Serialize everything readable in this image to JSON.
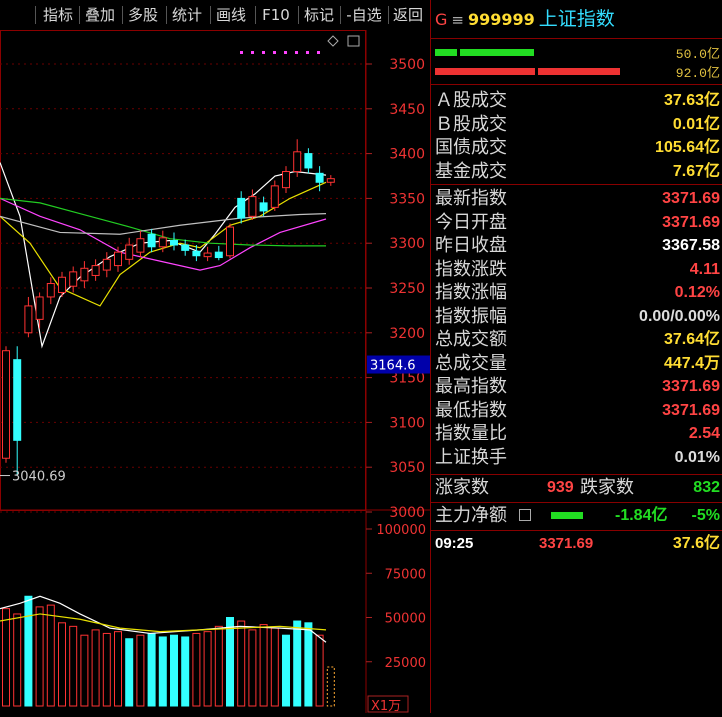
{
  "toolbar": {
    "buttons": [
      "指标",
      "叠加",
      "多股",
      "统计",
      "画线",
      "F10",
      "标记",
      "-自选",
      "返回"
    ]
  },
  "chart": {
    "price_ticks": [
      "3500",
      "3450",
      "3400",
      "3350",
      "3300",
      "3250",
      "3200",
      "3150",
      "3100",
      "3050",
      "3000"
    ],
    "current_price_label": "3164.6",
    "low_annotation": "3040.69",
    "volume_ticks": [
      "100000",
      "75000",
      "50000",
      "25000"
    ],
    "volume_unit": "X1万",
    "colors": {
      "up": "#ff3333",
      "down": "#33ffff",
      "ma_white": "#ffffff",
      "ma_yellow": "#e8e000",
      "ma_magenta": "#ff44ff",
      "ma_green": "#22cc22",
      "grid": "#8b0000"
    }
  },
  "chart_data": {
    "type": "candlestick",
    "price_axis": [
      3000,
      3500
    ],
    "candles": [
      {
        "o": 3060,
        "c": 3180,
        "h": 3185,
        "l": 3055,
        "up": true
      },
      {
        "o": 3170,
        "c": 3080,
        "h": 3185,
        "l": 3040.69,
        "up": false
      },
      {
        "o": 3200,
        "c": 3230,
        "h": 3240,
        "l": 3195,
        "up": true
      },
      {
        "o": 3215,
        "c": 3240,
        "h": 3245,
        "l": 3205,
        "up": true
      },
      {
        "o": 3240,
        "c": 3255,
        "h": 3262,
        "l": 3232,
        "up": true
      },
      {
        "o": 3245,
        "c": 3262,
        "h": 3268,
        "l": 3240,
        "up": true
      },
      {
        "o": 3252,
        "c": 3268,
        "h": 3274,
        "l": 3245,
        "up": true
      },
      {
        "o": 3258,
        "c": 3272,
        "h": 3280,
        "l": 3250,
        "up": true
      },
      {
        "o": 3264,
        "c": 3275,
        "h": 3282,
        "l": 3258,
        "up": true
      },
      {
        "o": 3270,
        "c": 3282,
        "h": 3290,
        "l": 3262,
        "up": true
      },
      {
        "o": 3275,
        "c": 3290,
        "h": 3296,
        "l": 3268,
        "up": true
      },
      {
        "o": 3282,
        "c": 3298,
        "h": 3306,
        "l": 3276,
        "up": true
      },
      {
        "o": 3290,
        "c": 3305,
        "h": 3314,
        "l": 3284,
        "up": true
      },
      {
        "o": 3310,
        "c": 3296,
        "h": 3316,
        "l": 3290,
        "up": false
      },
      {
        "o": 3296,
        "c": 3306,
        "h": 3314,
        "l": 3290,
        "up": true
      },
      {
        "o": 3303,
        "c": 3298,
        "h": 3312,
        "l": 3292,
        "up": false
      },
      {
        "o": 3298,
        "c": 3292,
        "h": 3304,
        "l": 3286,
        "up": false
      },
      {
        "o": 3291,
        "c": 3286,
        "h": 3298,
        "l": 3280,
        "up": false
      },
      {
        "o": 3285,
        "c": 3289,
        "h": 3296,
        "l": 3280,
        "up": true
      },
      {
        "o": 3290,
        "c": 3284,
        "h": 3297,
        "l": 3281,
        "up": false
      },
      {
        "o": 3286,
        "c": 3318,
        "h": 3322,
        "l": 3283,
        "up": true
      },
      {
        "o": 3350,
        "c": 3328,
        "h": 3358,
        "l": 3322,
        "up": false
      },
      {
        "o": 3330,
        "c": 3352,
        "h": 3360,
        "l": 3326,
        "up": true
      },
      {
        "o": 3345,
        "c": 3336,
        "h": 3352,
        "l": 3330,
        "up": false
      },
      {
        "o": 3340,
        "c": 3364,
        "h": 3370,
        "l": 3336,
        "up": true
      },
      {
        "o": 3362,
        "c": 3380,
        "h": 3386,
        "l": 3356,
        "up": true
      },
      {
        "o": 3380,
        "c": 3402,
        "h": 3416,
        "l": 3374,
        "up": true
      },
      {
        "o": 3400,
        "c": 3384,
        "h": 3406,
        "l": 3378,
        "up": false
      },
      {
        "o": 3378,
        "c": 3368,
        "h": 3386,
        "l": 3358,
        "up": false
      },
      {
        "o": 3368,
        "c": 3372,
        "h": 3376,
        "l": 3364,
        "up": true
      }
    ],
    "volumes": [
      {
        "v": 55000,
        "up": true
      },
      {
        "v": 52000,
        "up": true
      },
      {
        "v": 62000,
        "up": false
      },
      {
        "v": 56000,
        "up": true
      },
      {
        "v": 57000,
        "up": true
      },
      {
        "v": 47000,
        "up": true
      },
      {
        "v": 45000,
        "up": true
      },
      {
        "v": 40000,
        "up": true
      },
      {
        "v": 43000,
        "up": true
      },
      {
        "v": 41000,
        "up": true
      },
      {
        "v": 42000,
        "up": true
      },
      {
        "v": 38000,
        "up": false
      },
      {
        "v": 40000,
        "up": true
      },
      {
        "v": 41000,
        "up": false
      },
      {
        "v": 39000,
        "up": false
      },
      {
        "v": 40000,
        "up": false
      },
      {
        "v": 39000,
        "up": false
      },
      {
        "v": 41000,
        "up": true
      },
      {
        "v": 42000,
        "up": true
      },
      {
        "v": 45000,
        "up": true
      },
      {
        "v": 50000,
        "up": false
      },
      {
        "v": 48000,
        "up": true
      },
      {
        "v": 43000,
        "up": true
      },
      {
        "v": 46000,
        "up": true
      },
      {
        "v": 44000,
        "up": true
      },
      {
        "v": 40000,
        "up": false
      },
      {
        "v": 48000,
        "up": false
      },
      {
        "v": 47000,
        "up": false
      },
      {
        "v": 40000,
        "up": true
      },
      {
        "v": 22000,
        "up": true
      }
    ]
  },
  "header": {
    "market_letter": "G",
    "code": "999999",
    "name": "上证指数"
  },
  "ratio_bars": {
    "top_value": "50.0亿",
    "bottom_value": "92.0亿"
  },
  "turnover": [
    {
      "label": "Ａ股成交",
      "value": "37.63亿",
      "color": "#ffdd33"
    },
    {
      "label": "Ｂ股成交",
      "value": "0.01亿",
      "color": "#ffdd33"
    },
    {
      "label": "国债成交",
      "value": "105.64亿",
      "color": "#ffdd33"
    },
    {
      "label": "基金成交",
      "value": "7.67亿",
      "color": "#ffdd33"
    }
  ],
  "stats": [
    {
      "label": "最新指数",
      "value": "3371.69",
      "color": "#ff4444"
    },
    {
      "label": "今日开盘",
      "value": "3371.69",
      "color": "#ff4444"
    },
    {
      "label": "昨日收盘",
      "value": "3367.58",
      "color": "#ffffff"
    },
    {
      "label": "指数涨跌",
      "value": "4.11",
      "color": "#ff4444"
    },
    {
      "label": "指数涨幅",
      "value": "0.12%",
      "color": "#ff4444"
    },
    {
      "label": "指数振幅",
      "value": "0.00/0.00%",
      "color": "#dddddd"
    },
    {
      "label": "总成交额",
      "value": "37.64亿",
      "color": "#ffdd33"
    },
    {
      "label": "总成交量",
      "value": "447.4万",
      "color": "#ffdd33"
    },
    {
      "label": "最高指数",
      "value": "3371.69",
      "color": "#ff4444"
    },
    {
      "label": "最低指数",
      "value": "3371.69",
      "color": "#ff4444"
    },
    {
      "label": "指数量比",
      "value": "2.54",
      "color": "#ff4444"
    },
    {
      "label": "上证换手",
      "value": "0.01%",
      "color": "#dddddd"
    }
  ],
  "breadth": {
    "up_label": "涨家数",
    "up_count": "939",
    "down_label": "跌家数",
    "down_count": "832"
  },
  "main_flow": {
    "label": "主力净额",
    "value": "-1.84亿",
    "pct": "-5%"
  },
  "tick": {
    "time": "09:25",
    "price": "3371.69",
    "amount": "37.6亿"
  }
}
